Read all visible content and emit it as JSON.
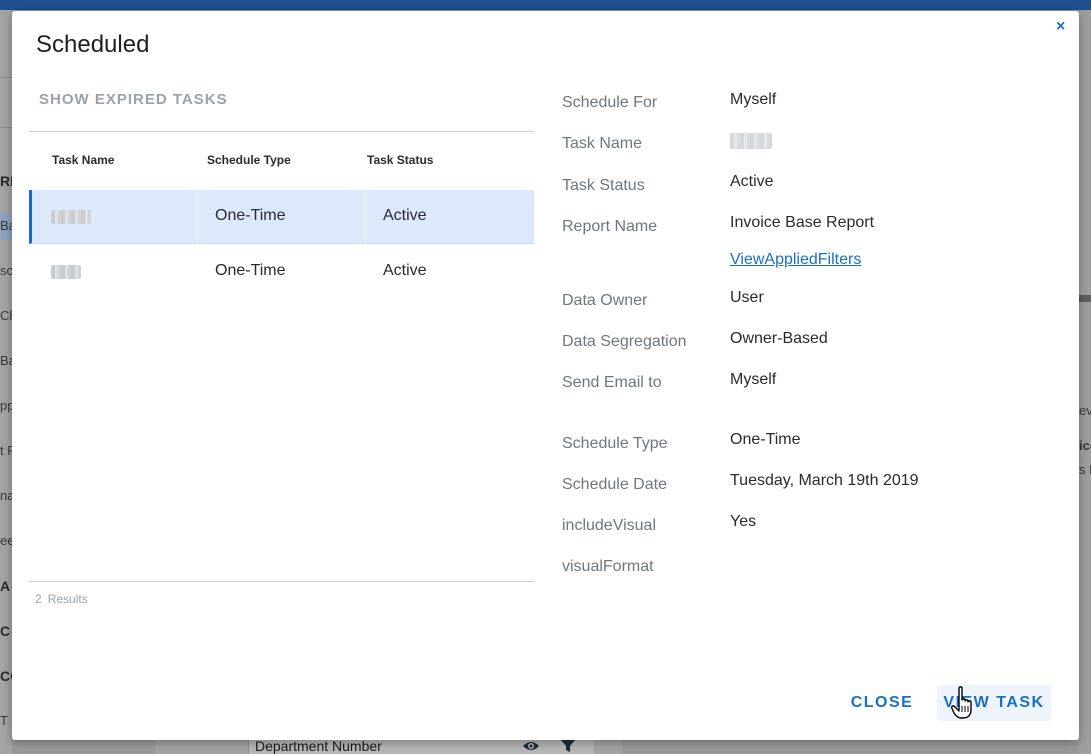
{
  "background": {
    "sidebar_fragments": [
      "RE",
      "Ba",
      "sc",
      "Ch",
      "Ba",
      "pp",
      "t F",
      "na",
      "ee",
      "A",
      "C",
      "CO",
      "T I"
    ],
    "right_fragments": [
      "ev",
      "ice",
      "s F"
    ],
    "bottom_field_text": "Department Number"
  },
  "modal": {
    "title": "Scheduled",
    "close_glyph": "×",
    "show_expired_label": "SHOW EXPIRED TASKS",
    "table": {
      "columns": [
        "Task Name",
        "Schedule Type",
        "Task Status"
      ],
      "rows": [
        {
          "schedule_type": "One-Time",
          "task_status": "Active"
        },
        {
          "schedule_type": "One-Time",
          "task_status": "Active"
        }
      ],
      "results_count": "2",
      "results_label": "Results"
    },
    "details": {
      "schedule_for": {
        "label": "Schedule For",
        "value": "Myself"
      },
      "task_name": {
        "label": "Task Name"
      },
      "task_status": {
        "label": "Task Status",
        "value": "Active"
      },
      "report_name": {
        "label": "Report Name",
        "value": "Invoice Base Report"
      },
      "view_filters_link": "ViewAppliedFilters",
      "data_owner": {
        "label": "Data Owner",
        "value": "User"
      },
      "data_segregation": {
        "label": "Data Segregation",
        "value": "Owner-Based"
      },
      "send_email_to": {
        "label": "Send Email to",
        "value": "Myself"
      },
      "schedule_type": {
        "label": "Schedule Type",
        "value": "One-Time"
      },
      "schedule_date": {
        "label": "Schedule Date",
        "value": "Tuesday, March 19th 2019"
      },
      "include_visual": {
        "label": "includeVisual",
        "value": "Yes"
      },
      "visual_format": {
        "label": "visualFormat"
      }
    },
    "buttons": {
      "close": "CLOSE",
      "view_task": "VIEW TASK"
    }
  },
  "colors": {
    "accent": "#1a6fc6",
    "selected_row": "#dce9fb",
    "topbar": "#1f4f8f"
  }
}
